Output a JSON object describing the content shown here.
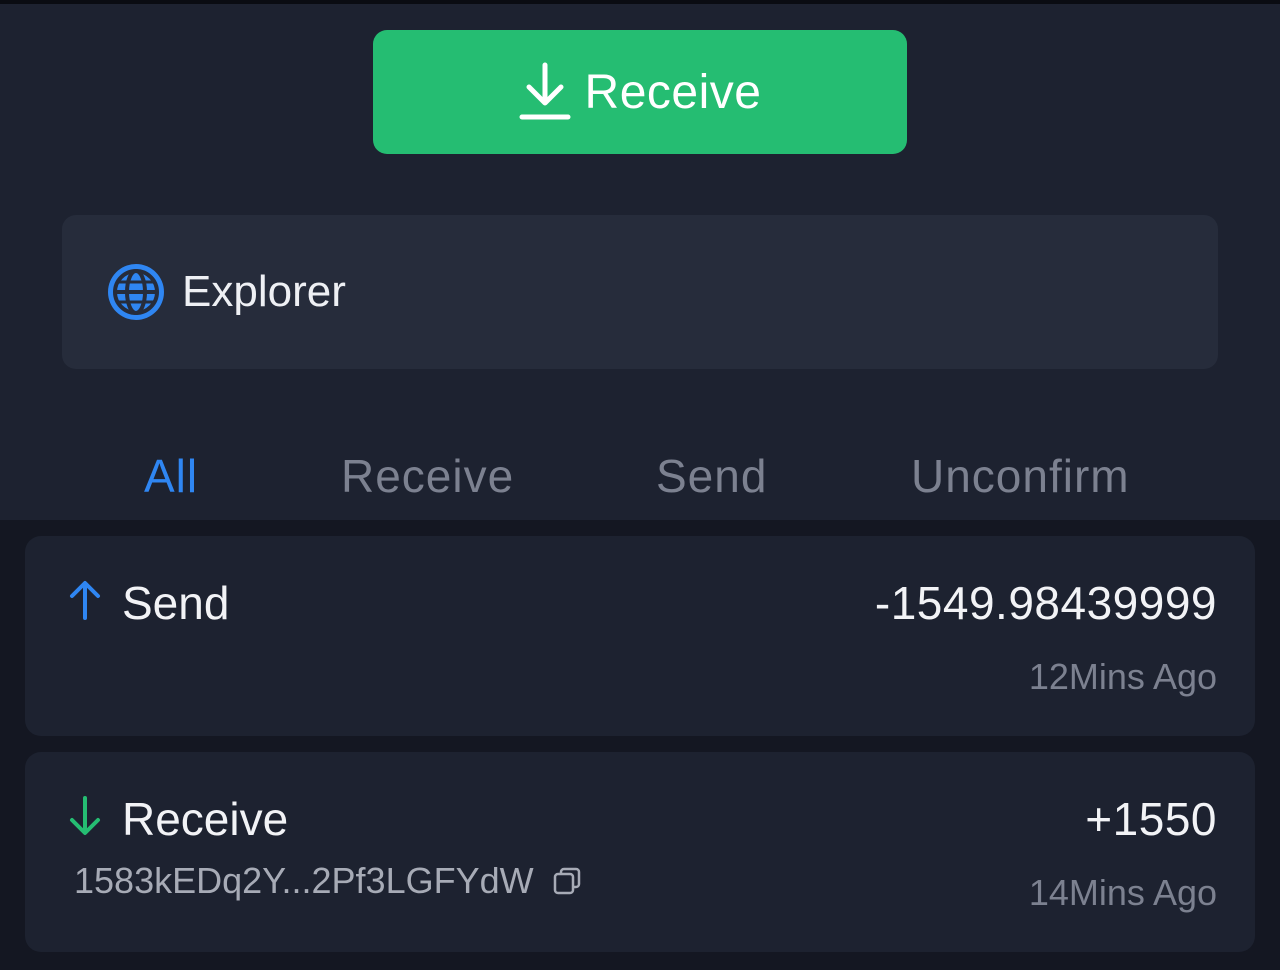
{
  "actions": {
    "receive_label": "Receive"
  },
  "explorer": {
    "label": "Explorer"
  },
  "tabs": [
    {
      "label": "All",
      "active": true
    },
    {
      "label": "Receive",
      "active": false
    },
    {
      "label": "Send",
      "active": false
    },
    {
      "label": "Unconfirm",
      "active": false
    }
  ],
  "transactions": [
    {
      "type": "Send",
      "direction_icon": "arrow-up-icon",
      "amount": "-1549.98439999",
      "time": "12Mins Ago",
      "address": ""
    },
    {
      "type": "Receive",
      "direction_icon": "arrow-down-icon",
      "amount": "+1550",
      "time": "14Mins Ago",
      "address": "1583kEDq2Y...2Pf3LGFYdW"
    }
  ],
  "colors": {
    "accent_green": "#25bd72",
    "accent_blue": "#2f86f2",
    "panel_bg": "#1d2230",
    "card_bg": "#262c3b",
    "page_bg": "#141722"
  }
}
